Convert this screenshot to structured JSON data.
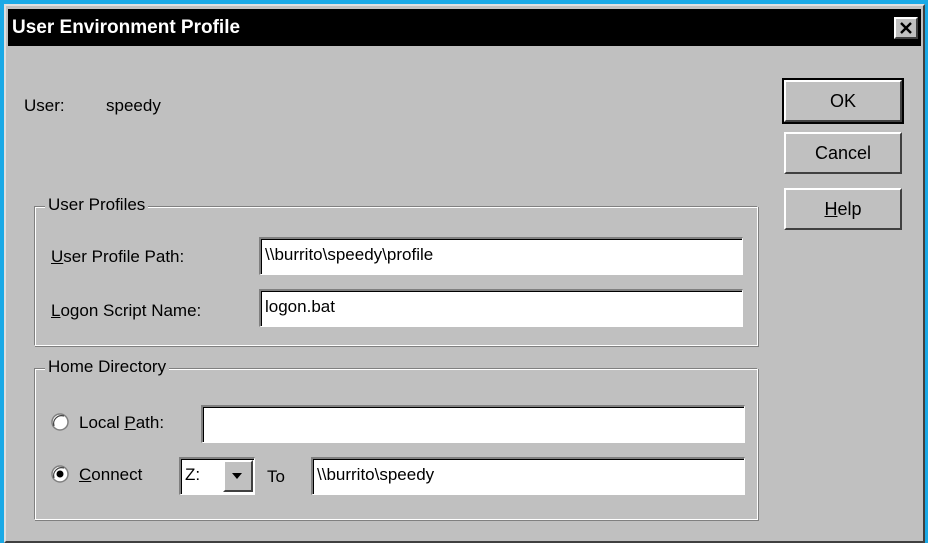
{
  "dialog": {
    "title": "User Environment Profile"
  },
  "user": {
    "label": "User:",
    "value": "speedy"
  },
  "buttons": {
    "ok": "OK",
    "cancel": "Cancel",
    "help_accel": "H",
    "help_rest": "elp"
  },
  "user_profiles": {
    "group_title": "User Profiles",
    "profile_path_accel": "U",
    "profile_path_rest": "ser Profile Path:",
    "profile_path_value": "\\\\burrito\\speedy\\profile",
    "logon_script_accel": "L",
    "logon_script_rest": "ogon Script Name:",
    "logon_script_value": "logon.bat"
  },
  "home_directory": {
    "group_title": "Home Directory",
    "local_path_pre": "Local ",
    "local_path_accel": "P",
    "local_path_rest": "ath:",
    "local_path_value": "",
    "local_path_selected": false,
    "connect_accel": "C",
    "connect_rest": "onnect",
    "connect_selected": true,
    "drive_value": "Z:",
    "to_label": "To",
    "connect_path_value": "\\\\burrito\\speedy"
  },
  "colors": {
    "title_bar": "#000000",
    "dialog_face": "#c0c0c0",
    "backdrop": "#1aa9e6"
  },
  "icons": {
    "close": "close-x-icon",
    "dropdown": "triangle-down-icon"
  }
}
